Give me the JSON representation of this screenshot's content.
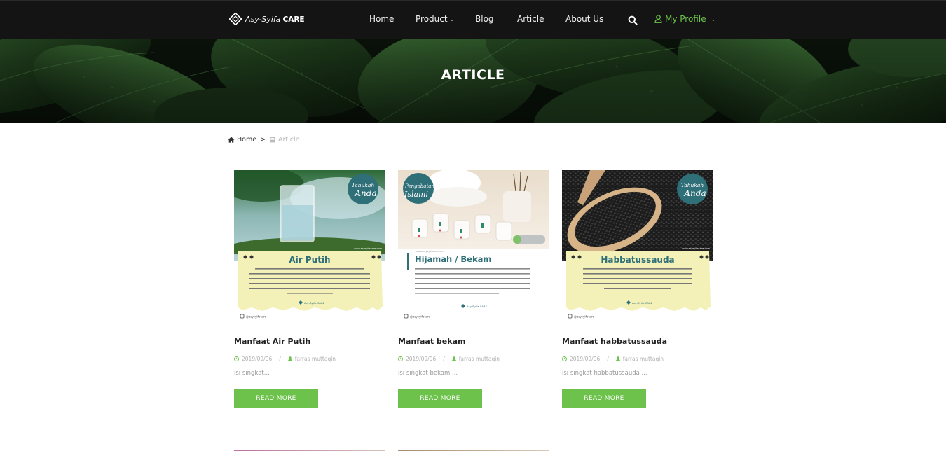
{
  "nav": {
    "logo_script": "Asy-Syifa",
    "logo_bold": "CARE",
    "items": [
      {
        "label": "Home"
      },
      {
        "label": "Product"
      },
      {
        "label": "Blog"
      },
      {
        "label": "Article"
      },
      {
        "label": "About Us"
      }
    ],
    "profile_label": "My Profile"
  },
  "hero": {
    "title": "ARTICLE"
  },
  "breadcrumb": {
    "home": "Home",
    "separator": ">",
    "current": "Article"
  },
  "articles": [
    {
      "title": "Manfaat Air Putih",
      "date": "2019/09/06",
      "author": "farras muttaqin",
      "excerpt": "isi singkat...",
      "button": "READ MORE",
      "image": {
        "badge_top": "Tahukah",
        "badge_bottom": "Anda",
        "heading": "Air Putih",
        "website": "www.asysyifacare.com",
        "brand": "Asy-Syifa CARE",
        "instagram": "@asysyifacare"
      }
    },
    {
      "title": "Manfaat bekam",
      "date": "2019/09/06",
      "author": "farras muttaqin",
      "excerpt": "isi singkat bekam ...",
      "button": "READ MORE",
      "image": {
        "badge_top": "Pengobatan",
        "badge_bottom": "Islami",
        "heading": "Hijamah / Bekam",
        "website": "www.asysyifacare.com",
        "brand": "Asy-Syifa CARE",
        "instagram": "@asysyifacare"
      }
    },
    {
      "title": "Manfaat habbatussauda",
      "date": "2019/09/06",
      "author": "farras muttaqin",
      "excerpt": "isi singkat habbatussauda ...",
      "button": "READ MORE",
      "image": {
        "badge_top": "Tahukah",
        "badge_bottom": "Anda",
        "heading": "Habbatussauda",
        "website": "www.asysyifacare.com",
        "brand": "Asy-Syifa CARE",
        "instagram": "@asysyifacare"
      }
    }
  ],
  "colors": {
    "accent": "#6cc24a",
    "navbar": "#141414",
    "badge": "#2e6f78",
    "paper": "#f3f1b8"
  }
}
